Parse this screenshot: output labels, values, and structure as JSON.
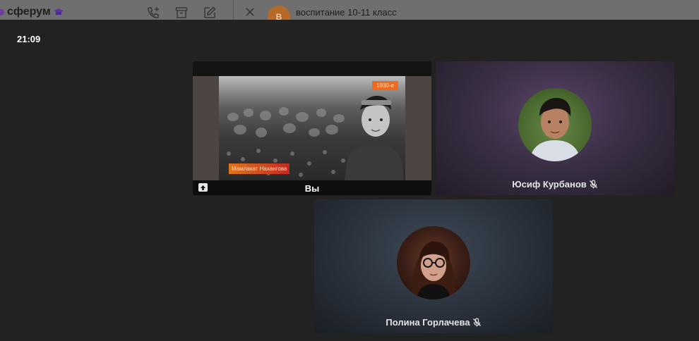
{
  "messenger": {
    "brand": "сферум",
    "chat_avatar_letter": "В",
    "chat_title": "воспитание 10-11 класс",
    "icons": [
      "call-add-icon",
      "archive-icon",
      "compose-icon",
      "close-icon"
    ]
  },
  "call": {
    "time": "21:09",
    "self_tile": {
      "label": "Вы",
      "share": {
        "year_badge": "1930-е",
        "name_badge": "Мамлакат Нахангова"
      }
    },
    "participants": [
      {
        "name": "Юсиф Курбанов",
        "muted": true
      },
      {
        "name": "Полина Горлачева",
        "muted": true
      }
    ]
  },
  "colors": {
    "background": "#222222",
    "brand_purple": "#6a3fa0",
    "year_badge": "#ee6a1f",
    "name_badge": "#c12a1e"
  }
}
